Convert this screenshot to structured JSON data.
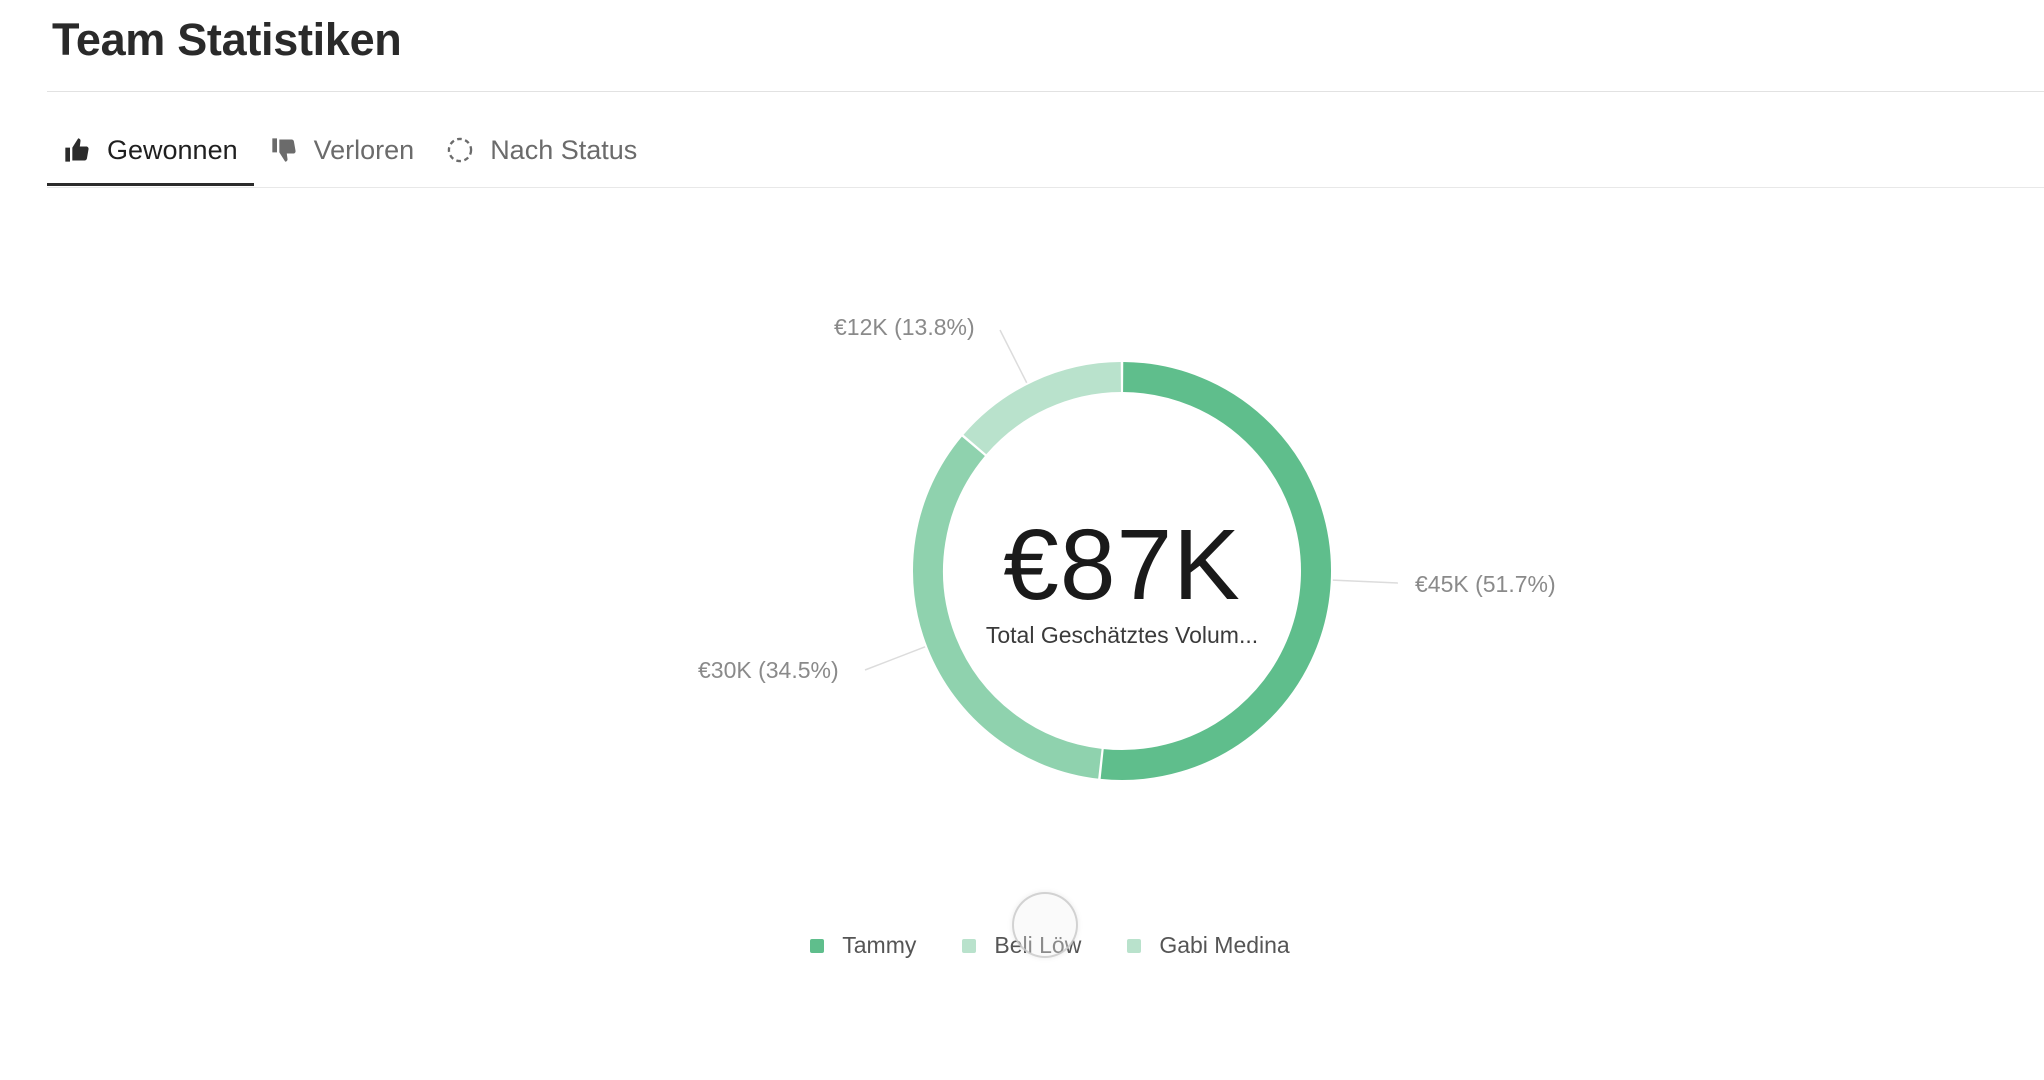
{
  "header": {
    "title": "Team Statistiken"
  },
  "tabs": [
    {
      "label": "Gewonnen",
      "icon": "thumbs-up-icon",
      "active": true
    },
    {
      "label": "Verloren",
      "icon": "thumbs-down-icon",
      "active": false
    },
    {
      "label": "Nach Status",
      "icon": "dashed-circle-icon",
      "active": false
    }
  ],
  "chart_data": {
    "type": "pie",
    "donut": true,
    "center_value": "€87K",
    "center_label": "Total Geschätztes Volum...",
    "categories": [
      "Tammy",
      "Beli Löw",
      "Gabi Medina"
    ],
    "values": [
      45,
      30,
      12
    ],
    "unit": "€K",
    "percentages": [
      51.7,
      34.5,
      13.8
    ],
    "data_labels": [
      "€45K (51.7%)",
      "€30K (34.5%)",
      "€12K (13.8%)"
    ],
    "colors": [
      "#5fbe8c",
      "#8fd2ae",
      "#b9e2cc"
    ],
    "legend": [
      {
        "name": "Tammy",
        "color": "#5fbe8c"
      },
      {
        "name": "Beli Löw",
        "color": "#b9e2cc"
      },
      {
        "name": "Gabi Medina",
        "color": "#b9e2cc"
      }
    ],
    "legend_position": "bottom"
  }
}
